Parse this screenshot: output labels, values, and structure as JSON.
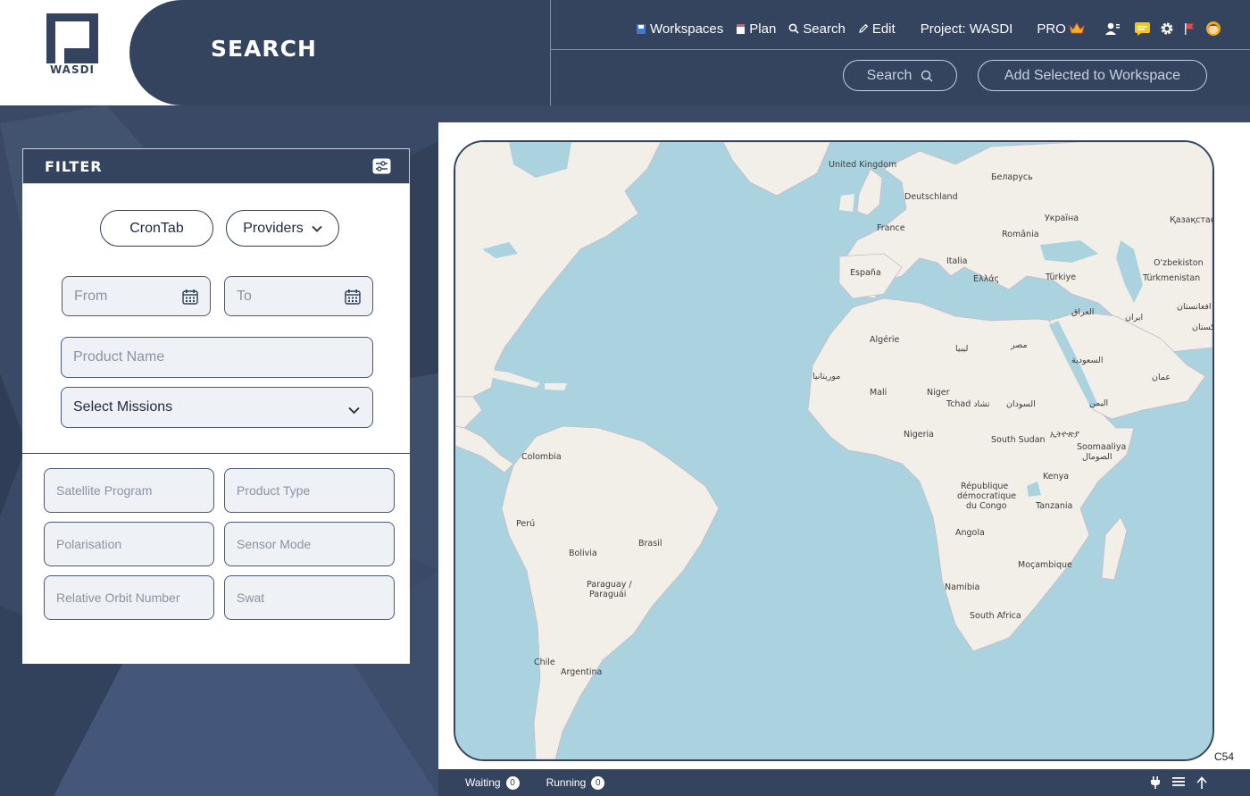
{
  "app": {
    "logo_text": "WASDI",
    "page_title": "SEARCH"
  },
  "topnav": {
    "workspaces": "Workspaces",
    "plan": "Plan",
    "search": "Search",
    "edit": "Edit",
    "project": "Project: WASDI",
    "pro": "PRO"
  },
  "header_actions": {
    "search_label": "Search",
    "add_label": "Add Selected to Workspace"
  },
  "filter": {
    "title": "FILTER",
    "crontab": "CronTab",
    "providers": "Providers",
    "from_placeholder": "From",
    "to_placeholder": "To",
    "product_name_placeholder": "Product Name",
    "missions_selected": "Select Missions",
    "fields": {
      "satellite_program": "Satellite Program",
      "product_type": "Product Type",
      "polarisation": "Polarisation",
      "sensor_mode": "Sensor Mode",
      "relative_orbit": "Relative Orbit Number",
      "swat": "Swat"
    }
  },
  "map": {
    "code": "C54",
    "labels": {
      "uk": "United Kingdom",
      "belarus": "Беларусь",
      "deutschland": "Deutschland",
      "ukraine": "Україна",
      "kazakhstan": "Қазақстан",
      "france": "France",
      "romania": "România",
      "italia": "Italia",
      "espana": "España",
      "ozbekiston": "O'zbekiston",
      "turkiye": "Türkiye",
      "ellas": "Ελλάς",
      "turkmenistan": "Türkmenistan",
      "afghanistan": "افغانستان",
      "iraq": "العراق",
      "iran": "ایران",
      "pakistan": "پاکستان",
      "algerie": "Algérie",
      "libya": "ليبيا",
      "misr": "مصر",
      "saudi": "السعودية",
      "mauritania": "موريتانيا",
      "oman": "عمان",
      "mali": "Mali",
      "niger": "Niger",
      "tchad": "Tchad تشاد",
      "sudan": "السودان",
      "yemen": "اليمن",
      "nigeria": "Nigeria",
      "south_sudan": "South Sudan",
      "ethiopia": "ኢትዮጵያ",
      "somalia1": "Soomaaliya",
      "somalia2": "الصومال",
      "colombia": "Colombia",
      "drc1": "République",
      "drc2": "démocratique",
      "drc3": "du Congo",
      "kenya": "Kenya",
      "tanzania": "Tanzania",
      "peru": "Perú",
      "brasil": "Brasil",
      "angola": "Angola",
      "bolivia": "Bolivia",
      "mozambique": "Moçambique",
      "paraguay1": "Paraguay /",
      "paraguay2": "Paraguái",
      "namibia": "Namibia",
      "south_africa": "South Africa",
      "chile": "Chile",
      "argentina": "Argentina"
    }
  },
  "status": {
    "waiting_label": "Waiting",
    "waiting_count": "0",
    "running_label": "Running",
    "running_count": "0"
  },
  "colors": {
    "navy": "#34445f",
    "ocean": "#aad3df",
    "land": "#f2efe9"
  },
  "icons": [
    "workspace-icon",
    "plan-icon",
    "search-icon",
    "edit-icon",
    "crown-icon",
    "user-icon",
    "chat-icon",
    "gear-icon",
    "flag-icon",
    "avatar-icon",
    "filter-settings-icon",
    "calendar-icon",
    "chevron-down-icon",
    "plug-icon",
    "menu-icon",
    "arrow-up-icon"
  ]
}
